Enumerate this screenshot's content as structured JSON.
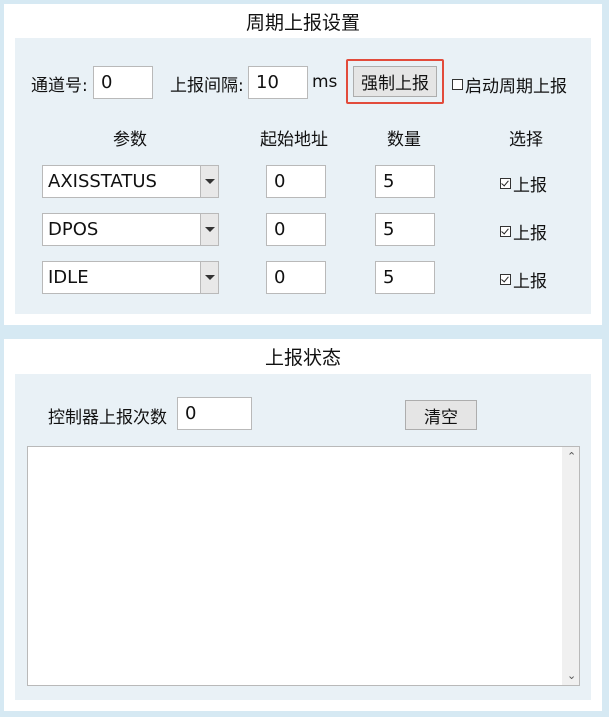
{
  "periodic": {
    "title": "周期上报设置",
    "channel_label": "通道号:",
    "channel_value": "0",
    "interval_label": "上报间隔:",
    "interval_value": "10",
    "interval_unit": "ms",
    "force_button": "强制上报",
    "enable_label": "启动周期上报",
    "enable_checked": false,
    "headers": [
      "参数",
      "起始地址",
      "数量",
      "选择"
    ],
    "rows": [
      {
        "param": "AXISSTATUS",
        "start": "0",
        "count": "5",
        "select_label": "上报",
        "checked": true
      },
      {
        "param": "DPOS",
        "start": "0",
        "count": "5",
        "select_label": "上报",
        "checked": true
      },
      {
        "param": "IDLE",
        "start": "0",
        "count": "5",
        "select_label": "上报",
        "checked": true
      }
    ]
  },
  "status": {
    "title": "上报状态",
    "count_label": "控制器上报次数",
    "count_value": "0",
    "clear_button": "清空",
    "log_text": ""
  },
  "colors": {
    "background": "#d6e9f3",
    "inner_panel": "#e9f1f6",
    "highlight": "#e24b3b"
  }
}
